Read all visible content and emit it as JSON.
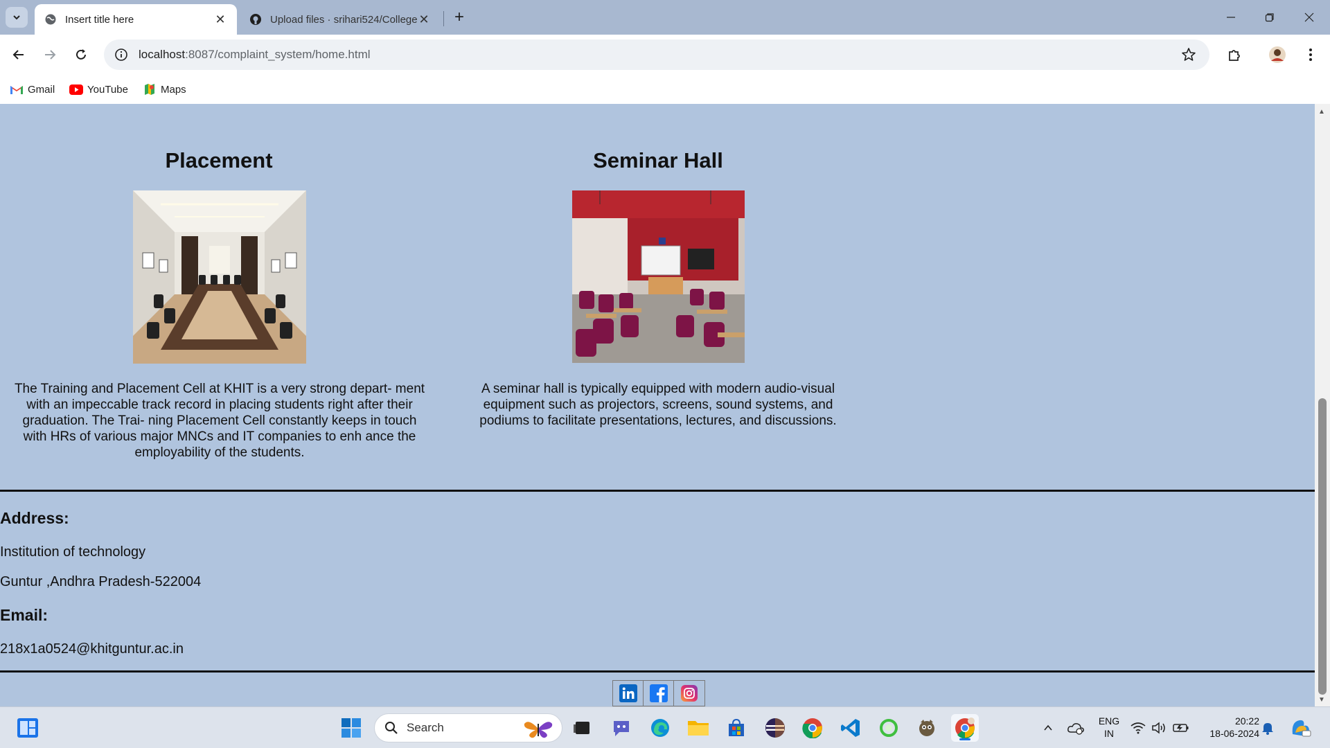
{
  "browser": {
    "tabs": [
      {
        "title": "Insert title here",
        "active": true,
        "icon": "globe-icon"
      },
      {
        "title": "Upload files · srihari524/College",
        "active": false,
        "icon": "github-icon"
      }
    ],
    "url_host": "localhost",
    "url_path": ":8087/complaint_system/home.html",
    "bookmarks": [
      {
        "label": "Gmail",
        "icon": "gmail-icon"
      },
      {
        "label": "YouTube",
        "icon": "youtube-icon"
      },
      {
        "label": "Maps",
        "icon": "maps-icon"
      }
    ]
  },
  "cards": [
    {
      "title": "Placement",
      "description": "The Training and Placement Cell at KHIT is a very strong depart- ment with an impeccable track record in placing students right after their graduation. The Trai- ning Placement Cell constantly keeps in touch with HRs of various major MNCs and IT companies to enh ance the employability of the students.",
      "image": "conference-room-photo"
    },
    {
      "title": "Seminar Hall",
      "description": "A seminar hall is typically equipped with modern audio-visual equipment such as projectors, screens, sound systems, and podiums to facilitate presentations, lectures, and discussions.",
      "image": "seminar-hall-photo"
    }
  ],
  "footer": {
    "address_heading": "Address:",
    "address_line1": "Institution of technology",
    "address_line2": "Guntur ,Andhra Pradesh-522004",
    "email_heading": "Email:",
    "email": "218x1a0524@khitguntur.ac.in",
    "social": [
      "linkedin-icon",
      "facebook-icon",
      "instagram-icon"
    ]
  },
  "taskbar": {
    "search_placeholder": "Search",
    "language_line1": "ENG",
    "language_line2": "IN",
    "time": "20:22",
    "date": "18-06-2024"
  },
  "colors": {
    "page_background": "#b0c4de",
    "accent": "#1a73e8"
  }
}
